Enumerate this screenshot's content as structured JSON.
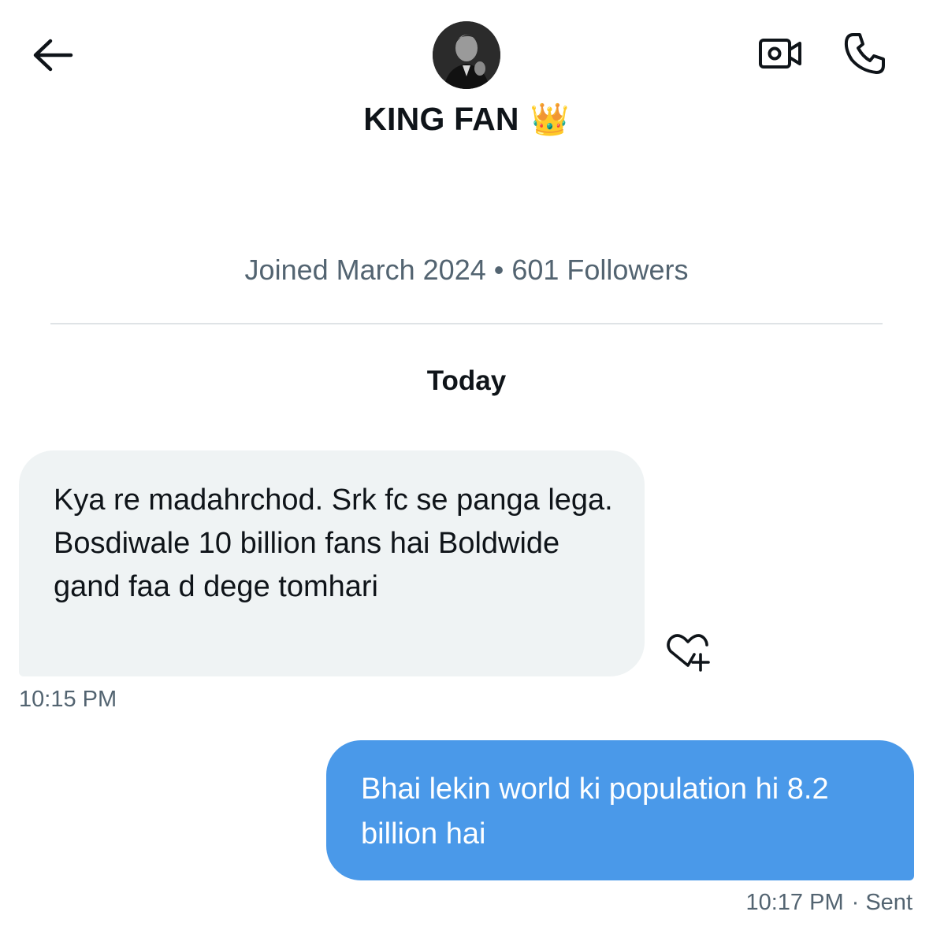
{
  "header": {
    "back_icon": "arrow-left-icon",
    "contact_name": "KING FAN",
    "contact_emoji": "👑",
    "video_icon": "video-call-icon",
    "call_icon": "phone-icon"
  },
  "profile": {
    "meta": "Joined March 2024 • 601 Followers"
  },
  "conversation": {
    "date_label": "Today",
    "messages": [
      {
        "direction": "incoming",
        "text": "Kya re madahrchod. Srk fc se panga lega. Bosdiwale 10 billion fans hai Boldwide gand faa d dege tomhari",
        "time": "10:15 PM"
      },
      {
        "direction": "outgoing",
        "text": "Bhai lekin world ki population hi 8.2 billion hai",
        "time": "10:17 PM",
        "status": "· Sent"
      }
    ]
  },
  "colors": {
    "outgoing_bubble": "#4a99e9",
    "incoming_bubble": "#eff3f4",
    "secondary_text": "#536471"
  }
}
